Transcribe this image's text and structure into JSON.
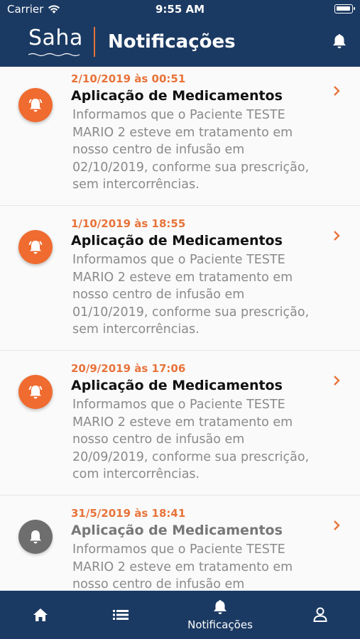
{
  "status_bar": {
    "carrier": "Carrier",
    "time": "9:55 AM"
  },
  "header": {
    "logo": "Saha",
    "title": "Notificações"
  },
  "notifications": [
    {
      "date": "2/10/2019 às 00:51",
      "title": "Aplicação de Medicamentos",
      "body": "Informamos que o Paciente TESTE MARIO 2 esteve em tratamento em nosso centro de infusão em 02/10/2019, conforme sua prescrição, sem intercorrências.",
      "read": false
    },
    {
      "date": "1/10/2019 às 18:55",
      "title": "Aplicação de Medicamentos",
      "body": "Informamos que o Paciente TESTE MARIO 2 esteve em tratamento em nosso centro de infusão em 01/10/2019, conforme sua prescrição, sem intercorrências.",
      "read": false
    },
    {
      "date": "20/9/2019 às 17:06",
      "title": "Aplicação de Medicamentos",
      "body": "Informamos que o Paciente TESTE MARIO 2 esteve em tratamento em nosso centro de infusão em 20/09/2019, conforme sua prescrição, com intercorrências.",
      "read": false
    },
    {
      "date": "31/5/2019 às 18:41",
      "title": "Aplicação de Medicamentos",
      "body": "Informamos que o Paciente TESTE MARIO 2 esteve em tratamento em nosso centro de infusão em",
      "read": true
    }
  ],
  "tabbar": {
    "tabs": [
      {
        "name": "home",
        "icon": "home-icon",
        "label": ""
      },
      {
        "name": "list",
        "icon": "list-icon",
        "label": ""
      },
      {
        "name": "notifications",
        "icon": "bell-icon",
        "label": "Notificações"
      },
      {
        "name": "profile",
        "icon": "user-icon",
        "label": ""
      }
    ]
  },
  "colors": {
    "navy": "#1b3a63",
    "accent": "#e8733a",
    "unread_icon": "#ef6b2f",
    "read_icon": "#6e6e6e"
  }
}
